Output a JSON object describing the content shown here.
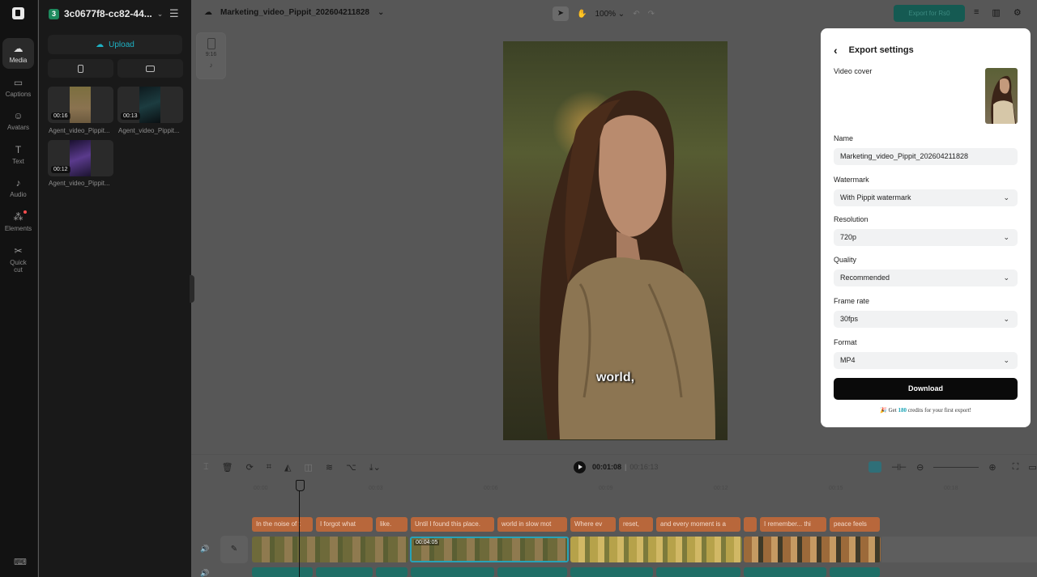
{
  "project": {
    "badge": "3",
    "name": "3c0677f8-cc82-44..."
  },
  "rail": {
    "items": [
      {
        "label": "Media",
        "icon": "cloud-icon"
      },
      {
        "label": "Captions",
        "icon": "captions-icon"
      },
      {
        "label": "Avatars",
        "icon": "avatar-icon"
      },
      {
        "label": "Text",
        "icon": "text-icon"
      },
      {
        "label": "Audio",
        "icon": "music-icon"
      },
      {
        "label": "Elements",
        "icon": "elements-icon"
      },
      {
        "label": "Quick cut",
        "icon": "quick-cut-icon"
      }
    ]
  },
  "media": {
    "upload_label": "Upload",
    "items": [
      {
        "duration": "00:16",
        "label": "Agent_video_Pippit..."
      },
      {
        "duration": "00:13",
        "label": "Agent_video_Pippit..."
      },
      {
        "duration": "00:12",
        "label": "Agent_video_Pippit..."
      }
    ]
  },
  "topbar": {
    "file_name": "Marketing_video_Pippit_202604211828",
    "zoom": "100%",
    "export_label": "Export for Rs0"
  },
  "ratio": {
    "label": "9:16"
  },
  "video": {
    "caption": "world,"
  },
  "export": {
    "title": "Export settings",
    "cover_label": "Video cover",
    "name_label": "Name",
    "name_value": "Marketing_video_Pippit_202604211828",
    "watermark_label": "Watermark",
    "watermark_value": "With Pippit watermark",
    "resolution_label": "Resolution",
    "resolution_value": "720p",
    "quality_label": "Quality",
    "quality_value": "Recommended",
    "framerate_label": "Frame rate",
    "framerate_value": "30fps",
    "format_label": "Format",
    "format_value": "MP4",
    "download_label": "Download",
    "credits_pre": "Get ",
    "credits_amount": "180",
    "credits_post": " credits for your first export!"
  },
  "timeline": {
    "current_time": "00:01:08",
    "total_time": "00:16:13",
    "ruler": [
      "00:00",
      "00:03",
      "00:06",
      "00:09",
      "00:12",
      "00:15",
      "00:18"
    ],
    "clip_stamp": "00:04:05",
    "captions": [
      "In the noise of t",
      "I forgot what",
      "like.",
      "Until I found this place.",
      "world in slow mot",
      "Where ev",
      "reset,",
      "and every moment is a",
      "",
      "I remember... thi",
      "peace feels"
    ]
  }
}
